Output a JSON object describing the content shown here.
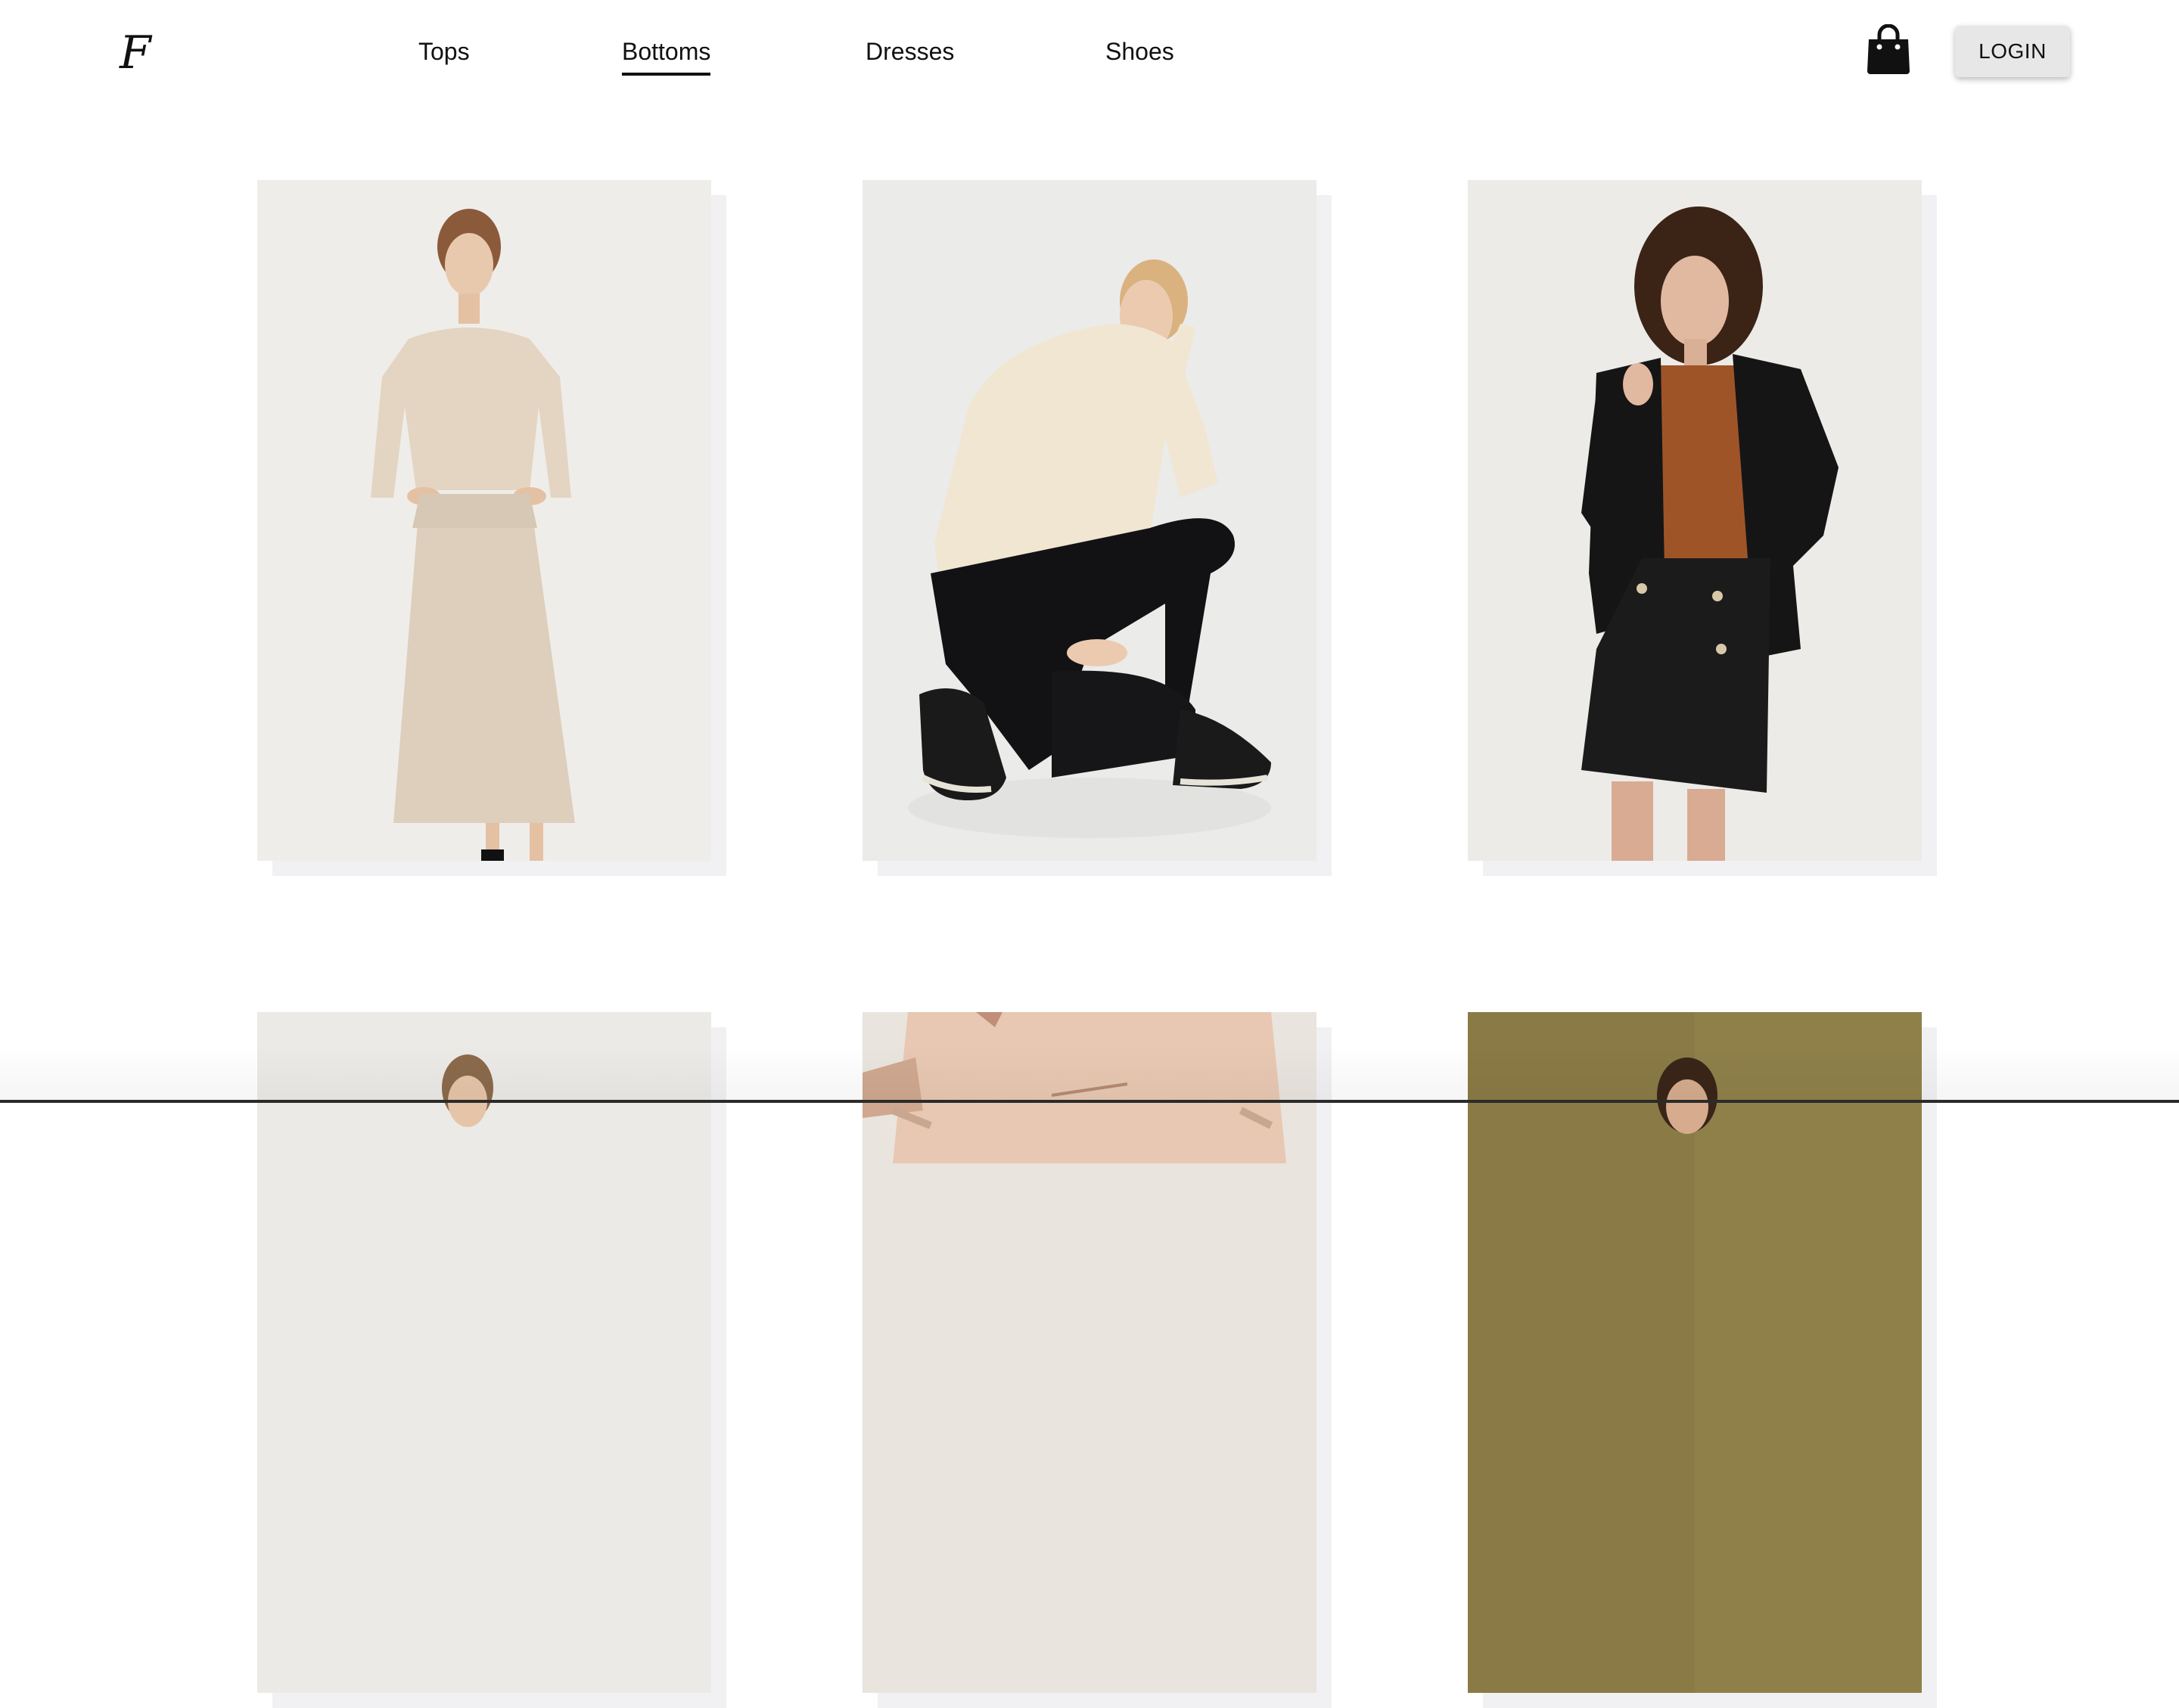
{
  "header": {
    "logo": "F",
    "nav": [
      {
        "label": "Tops",
        "active": false
      },
      {
        "label": "Bottoms",
        "active": true
      },
      {
        "label": "Dresses",
        "active": false
      },
      {
        "label": "Shoes",
        "active": false
      }
    ],
    "cart_icon": "shopping-bag-icon",
    "login_label": "LOGIN"
  },
  "products": [
    {
      "name": "beige-knit-set",
      "alt": "Model in beige sweater and midi skirt"
    },
    {
      "name": "cream-turtleneck-black-jeans",
      "alt": "Model crouching in cream turtleneck and black jeans"
    },
    {
      "name": "black-tweed-skirt-blazer",
      "alt": "Model in black tweed blazer and mini skirt"
    },
    {
      "name": "beige-outfit-2",
      "alt": ""
    },
    {
      "name": "camisole-top",
      "alt": ""
    },
    {
      "name": "olive-background-look",
      "alt": ""
    }
  ],
  "colors": {
    "text": "#111111",
    "login_bg": "#e7e7e7",
    "photo_bg": "#ececea",
    "olive_bg": "#8a7a45"
  }
}
